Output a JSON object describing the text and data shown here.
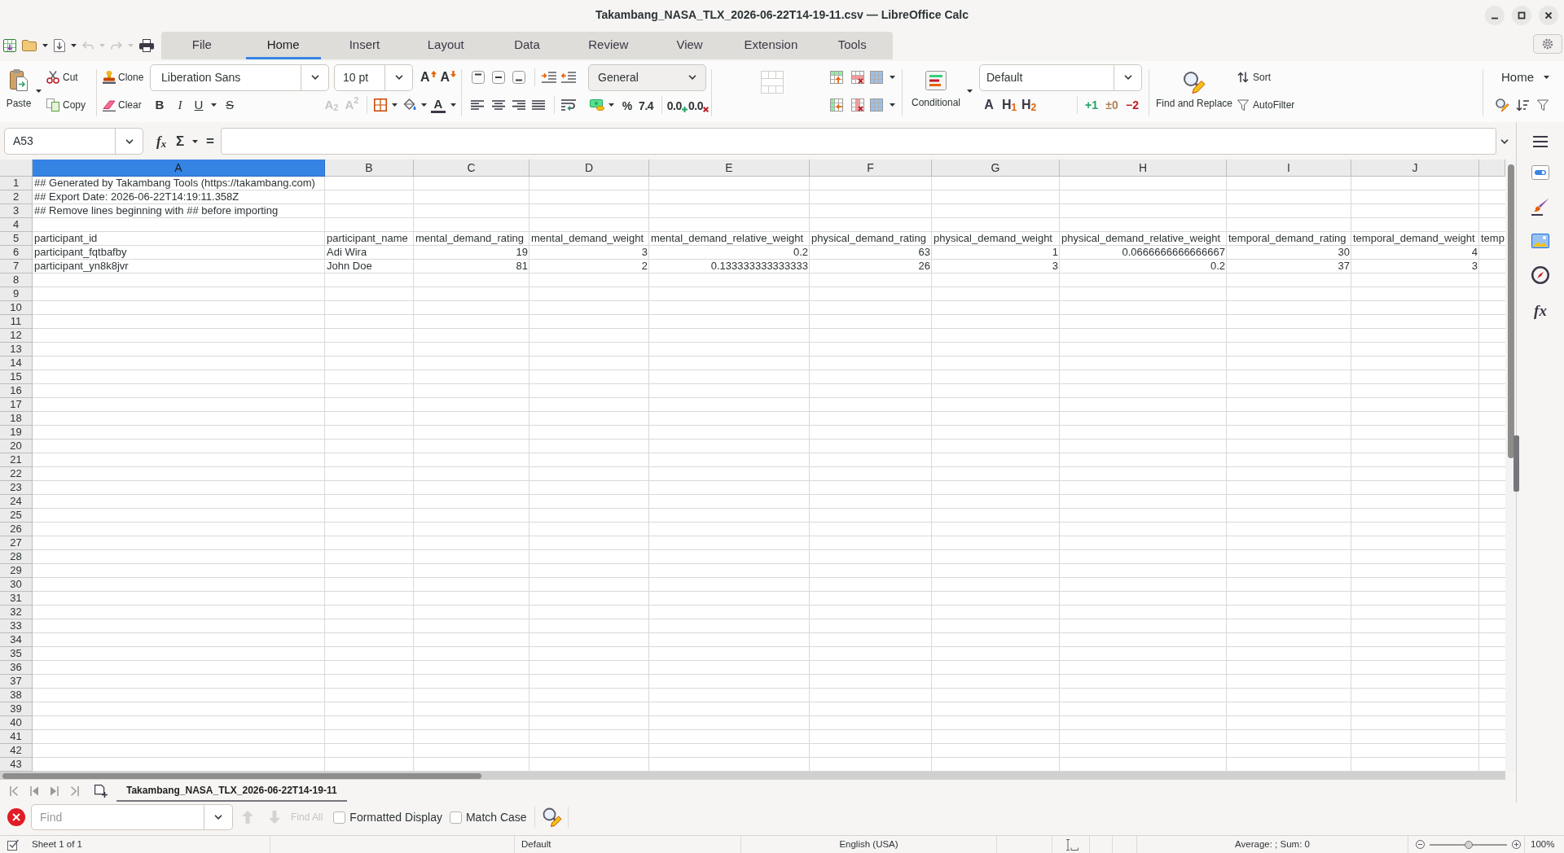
{
  "window": {
    "title": "Takambang_NASA_TLX_2026-06-22T14-19-11.csv — LibreOffice Calc"
  },
  "quick_access": {
    "undo": {
      "disabled": true
    },
    "redo": {
      "disabled": true
    }
  },
  "tabs": [
    {
      "label": "File",
      "selected": false
    },
    {
      "label": "Home",
      "selected": true
    },
    {
      "label": "Insert",
      "selected": false
    },
    {
      "label": "Layout",
      "selected": false
    },
    {
      "label": "Data",
      "selected": false
    },
    {
      "label": "Review",
      "selected": false
    },
    {
      "label": "View",
      "selected": false
    },
    {
      "label": "Extension",
      "selected": false
    },
    {
      "label": "Tools",
      "selected": false
    }
  ],
  "ribbon": {
    "paste": "Paste",
    "cut": "Cut",
    "copy": "Copy",
    "clone": "Clone",
    "clear": "Clear",
    "font_name": "Liberation Sans",
    "font_size": "10 pt",
    "font_size_buttons": [
      "A",
      "A"
    ],
    "emphasis_buttons": [
      "B",
      "I",
      "U",
      "S"
    ],
    "script_buttons": [
      {
        "label": "A$_{2}$",
        "disabled": true
      },
      {
        "label": "A$^{2}$",
        "disabled": true
      }
    ],
    "font_color": "A",
    "number_format": "General",
    "number_buttons": [
      "%",
      "7.4",
      "0.0",
      "0.0"
    ],
    "merge_cells": {
      "disabled": true
    },
    "conditional": "Conditional",
    "cell_style": "Default",
    "style_buttons": [
      "A",
      "H$_{1}$",
      "H$_{2}$"
    ],
    "status_style_buttons": [
      "+1",
      "±0",
      "−2"
    ],
    "find_replace": "Find and Replace",
    "sort": "Sort",
    "autofilter": "AutoFilter",
    "menu": "Home"
  },
  "formula_bar": {
    "name_box": "A53",
    "buttons": [
      "f$_{x}$",
      "Σ",
      "="
    ]
  },
  "sheet": {
    "columns": [
      {
        "label": "A",
        "selected": true,
        "kind": "text"
      },
      {
        "label": "B",
        "selected": false,
        "kind": "text"
      },
      {
        "label": "C",
        "selected": false,
        "kind": "number"
      },
      {
        "label": "D",
        "selected": false,
        "kind": "number"
      },
      {
        "label": "E",
        "selected": false,
        "kind": "number"
      },
      {
        "label": "F",
        "selected": false,
        "kind": "number"
      },
      {
        "label": "G",
        "selected": false,
        "kind": "number"
      },
      {
        "label": "H",
        "selected": false,
        "kind": "number"
      },
      {
        "label": "I",
        "selected": false,
        "kind": "number"
      },
      {
        "label": "J",
        "selected": false,
        "kind": "number"
      },
      {
        "selected": false,
        "kind": "number"
      }
    ],
    "rows": [
      {
        "label": "1",
        "selected": false,
        "cells": [
          "## Generated by Takambang Tools (https://takambang.com)"
        ]
      },
      {
        "label": "2",
        "selected": false,
        "cells": [
          "## Export Date: 2026-06-22T14:19:11.358Z"
        ]
      },
      {
        "label": "3",
        "selected": false,
        "cells": [
          "## Remove lines beginning with ## before importing"
        ]
      },
      {
        "label": "4",
        "selected": false
      },
      {
        "label": "5",
        "selected": false,
        "kind": "header",
        "cells": [
          "participant_id",
          "participant_name",
          "mental_demand_rating",
          "mental_demand_weight",
          "mental_demand_relative_weight",
          "physical_demand_rating",
          "physical_demand_weight",
          "physical_demand_relative_weight",
          "temporal_demand_rating",
          "temporal_demand_weight",
          "temp"
        ]
      },
      {
        "label": "6",
        "selected": false,
        "kind": "data",
        "cells": [
          "participant_fqtbafby",
          "Adi Wira",
          "19",
          "3",
          "0.2",
          "63",
          "1",
          "0.0666666666666667",
          "30",
          "4"
        ]
      },
      {
        "label": "7",
        "selected": false,
        "kind": "data",
        "cells": [
          "participant_yn8k8jvr",
          "John Doe",
          "81",
          "2",
          "0.133333333333333",
          "26",
          "3",
          "0.2",
          "37",
          "3"
        ]
      },
      {
        "label": "8",
        "selected": false
      },
      {
        "label": "9",
        "selected": false
      },
      {
        "label": "10",
        "selected": false
      },
      {
        "label": "11",
        "selected": false
      },
      {
        "label": "12",
        "selected": false
      },
      {
        "label": "13",
        "selected": false
      },
      {
        "label": "14",
        "selected": false
      },
      {
        "label": "15",
        "selected": false
      },
      {
        "label": "16",
        "selected": false
      },
      {
        "label": "17",
        "selected": false
      },
      {
        "label": "18",
        "selected": false
      },
      {
        "label": "19",
        "selected": false
      },
      {
        "label": "20",
        "selected": false
      },
      {
        "label": "21",
        "selected": false
      },
      {
        "label": "22",
        "selected": false
      },
      {
        "label": "23",
        "selected": false
      },
      {
        "label": "24",
        "selected": false
      },
      {
        "label": "25",
        "selected": false
      },
      {
        "label": "26",
        "selected": false
      },
      {
        "label": "27",
        "selected": false
      },
      {
        "label": "28",
        "selected": false
      },
      {
        "label": "29",
        "selected": false
      },
      {
        "label": "30",
        "selected": false
      },
      {
        "label": "31",
        "selected": false
      },
      {
        "label": "32",
        "selected": false
      },
      {
        "label": "33",
        "selected": false
      },
      {
        "label": "34",
        "selected": false
      },
      {
        "label": "35",
        "selected": false
      },
      {
        "label": "36",
        "selected": false
      },
      {
        "label": "37",
        "selected": false
      },
      {
        "label": "38",
        "selected": false
      },
      {
        "label": "39",
        "selected": false
      },
      {
        "label": "40",
        "selected": false
      },
      {
        "label": "41",
        "selected": false
      },
      {
        "label": "42",
        "selected": false
      },
      {
        "label": "43",
        "selected": false
      }
    ]
  },
  "sheet_tabs": [
    {
      "label": "Takambang_NASA_TLX_2026-06-22T14-19-11",
      "selected": true
    }
  ],
  "sidebar": {
    "functions": "fx"
  },
  "find_bar": {
    "placeholder": "Find",
    "previous": {
      "disabled": true
    },
    "next": {
      "disabled": true
    },
    "find_all": {
      "label": "Find All",
      "disabled": true
    },
    "options": [
      {
        "label": "Formatted Display",
        "checked": false
      },
      {
        "label": "Match Case",
        "checked": false
      }
    ]
  },
  "status_bar": {
    "sheet": "Sheet 1 of 1",
    "page_style": "Default",
    "language": "English (USA)",
    "summary": "Average: ; Sum: 0",
    "zoom": {
      "level": 0.5,
      "label": "100%"
    }
  }
}
